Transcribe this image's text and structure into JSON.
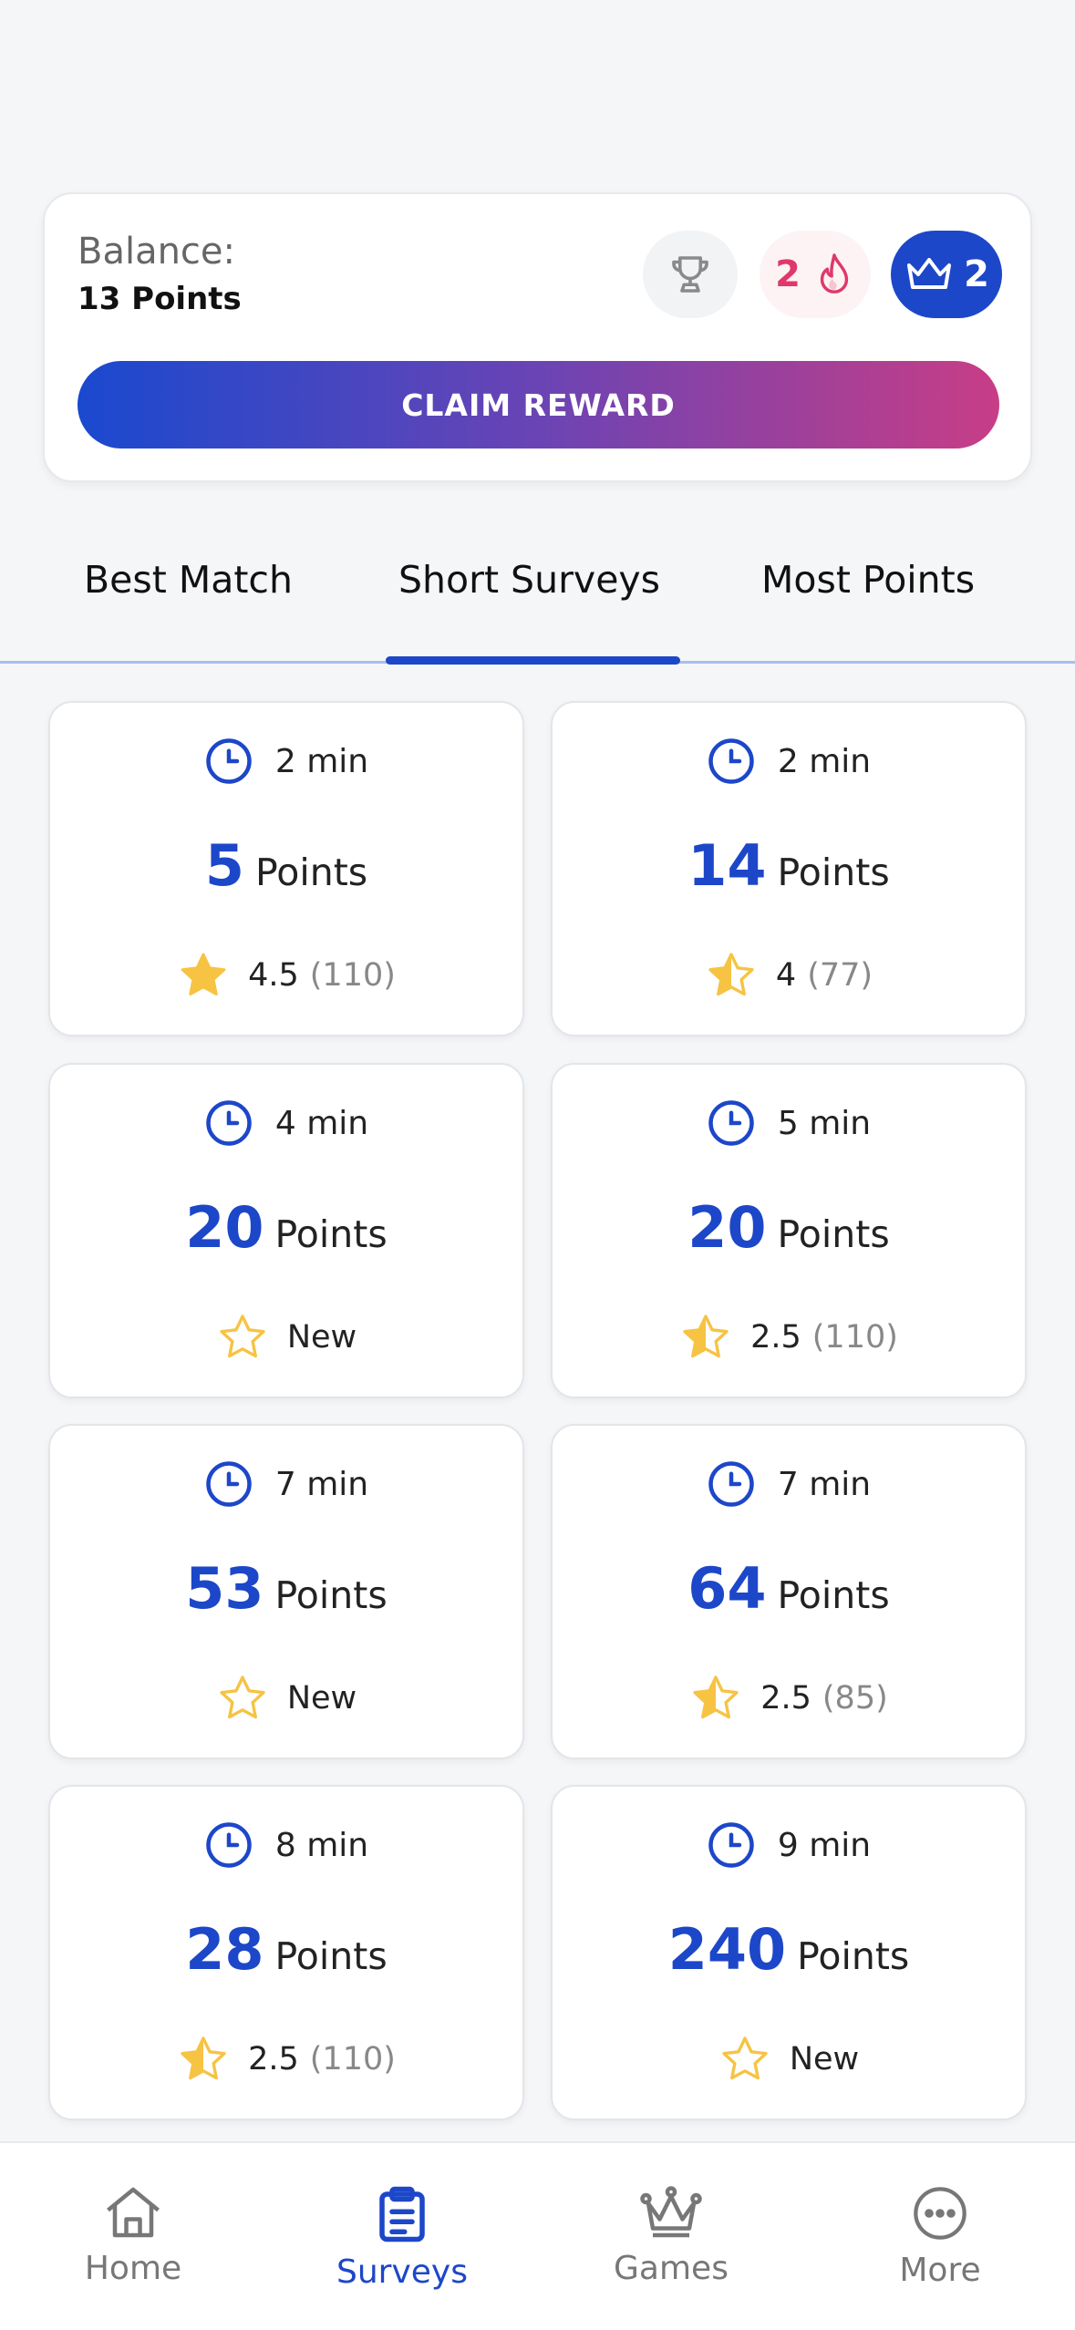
{
  "balance": {
    "label": "Balance:",
    "value": "13 Points",
    "streak_count": "2",
    "crown_count": "2",
    "claim_label": "CLAIM REWARD"
  },
  "tabs": [
    {
      "label": "Best Match",
      "active": false
    },
    {
      "label": "Short Surveys",
      "active": true
    },
    {
      "label": "Most Points",
      "active": false
    }
  ],
  "surveys": [
    {
      "time": "2 min",
      "points": "5",
      "points_label": "Points",
      "rating": "4.5",
      "count": "(110)",
      "star": "full"
    },
    {
      "time": "2 min",
      "points": "14",
      "points_label": "Points",
      "rating": "4",
      "count": "(77)",
      "star": "half"
    },
    {
      "time": "4 min",
      "points": "20",
      "points_label": "Points",
      "rating": "New",
      "count": "",
      "star": "outline"
    },
    {
      "time": "5 min",
      "points": "20",
      "points_label": "Points",
      "rating": "2.5",
      "count": "(110)",
      "star": "half"
    },
    {
      "time": "7 min",
      "points": "53",
      "points_label": "Points",
      "rating": "New",
      "count": "",
      "star": "outline"
    },
    {
      "time": "7 min",
      "points": "64",
      "points_label": "Points",
      "rating": "2.5",
      "count": "(85)",
      "star": "half"
    },
    {
      "time": "8 min",
      "points": "28",
      "points_label": "Points",
      "rating": "2.5",
      "count": "(110)",
      "star": "half"
    },
    {
      "time": "9 min",
      "points": "240",
      "points_label": "Points",
      "rating": "New",
      "count": "",
      "star": "outline"
    }
  ],
  "nav": [
    {
      "label": "Home",
      "icon": "home-icon",
      "active": false
    },
    {
      "label": "Surveys",
      "icon": "clipboard-icon",
      "active": true
    },
    {
      "label": "Games",
      "icon": "crown-icon",
      "active": false
    },
    {
      "label": "More",
      "icon": "more-icon",
      "active": false
    }
  ],
  "colors": {
    "accent": "#1d47c9",
    "streak": "#e0386a",
    "star": "#f6c343",
    "gradient_start": "#1a49cf",
    "gradient_end": "#c83d86"
  }
}
